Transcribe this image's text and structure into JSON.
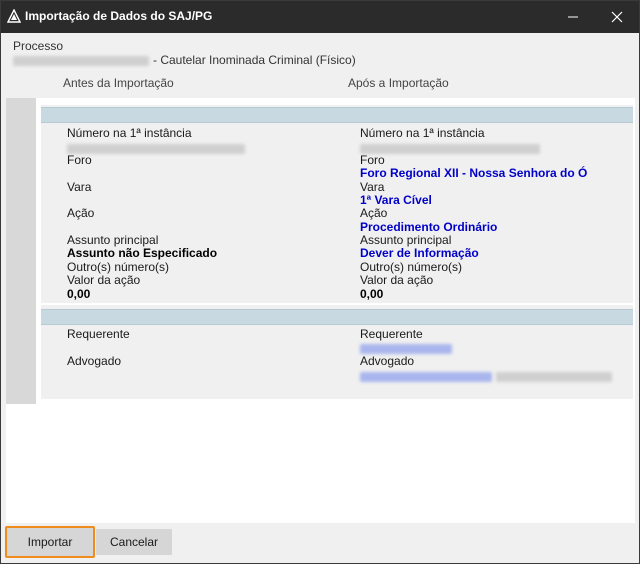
{
  "window": {
    "title": "Importação de Dados do SAJ/PG",
    "icons": [
      "app-logo-icon",
      "minimize-icon",
      "close-icon"
    ]
  },
  "process": {
    "label": "Processo",
    "description": "- Cautelar Inominada Criminal (Físico)"
  },
  "columns": {
    "before": "Antes da Importação",
    "after": "Após a Importação"
  },
  "before": {
    "numero_label": "Número na 1ª instância",
    "foro_label": "Foro",
    "vara_label": "Vara",
    "acao_label": "Ação",
    "assunto_label": "Assunto principal",
    "assunto_value": "Assunto não Especificado",
    "outros_label": "Outro(s) número(s)",
    "valor_label": "Valor da ação",
    "valor_value": "0,00",
    "requerente_label": "Requerente",
    "advogado_label": "Advogado"
  },
  "after": {
    "numero_label": "Número na 1ª instância",
    "foro_label": "Foro",
    "foro_value": "Foro Regional XII - Nossa Senhora do Ó",
    "vara_label": "Vara",
    "vara_value": "1ª Vara Cível",
    "acao_label": "Ação",
    "acao_value": "Procedimento Ordinário",
    "assunto_label": "Assunto principal",
    "assunto_value": "Dever de Informação",
    "outros_label": "Outro(s) número(s)",
    "valor_label": "Valor da ação",
    "valor_value": "0,00",
    "requerente_label": "Requerente",
    "advogado_label": "Advogado"
  },
  "buttons": {
    "import": "Importar",
    "cancel": "Cancelar"
  },
  "colors": {
    "titlebar": "#2b2b2b",
    "value_blue": "#0000c8",
    "section_band": "#c8d9e2",
    "focus_border": "#f08c1e"
  }
}
